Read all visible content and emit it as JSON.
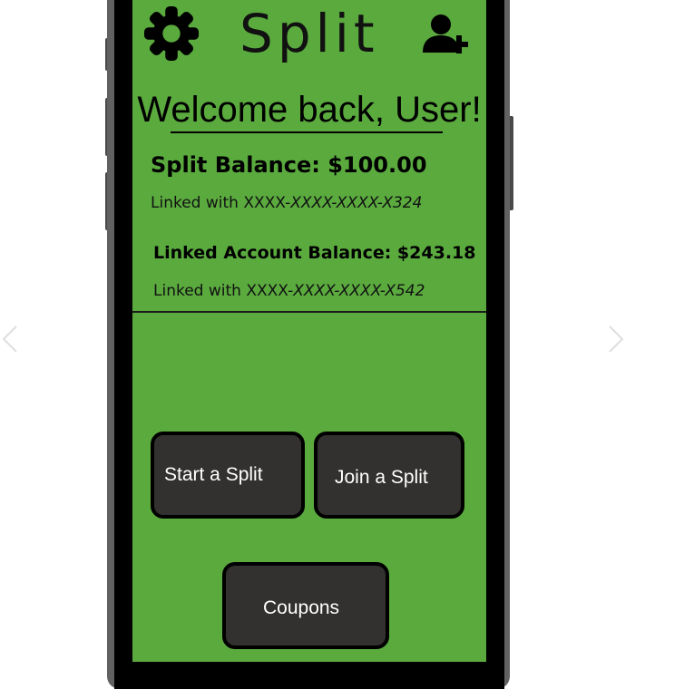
{
  "app": {
    "title": "Split"
  },
  "header": {
    "settings_icon": "gear-icon",
    "add_user_icon": "add-user-icon"
  },
  "welcome": {
    "text": "Welcome back, User!"
  },
  "accounts": {
    "split_balance_label": "Split Balance: $100.00",
    "split_linked_prefix": "Linked with XXXX-",
    "split_linked_masked": "XXXX-XXXX-X324",
    "linked_balance_label": "Linked Account Balance: $243.18",
    "linked_linked_prefix": "Linked with XXXX-",
    "linked_linked_masked": "XXXX-XXXX-X542"
  },
  "actions": {
    "start_split": "Start a Split",
    "join_split": "Join a Split",
    "coupons": "Coupons"
  },
  "colors": {
    "screen_background": "#5aaa3e",
    "button_background": "#333130",
    "button_text": "#ffffff",
    "frame": "#616161"
  }
}
